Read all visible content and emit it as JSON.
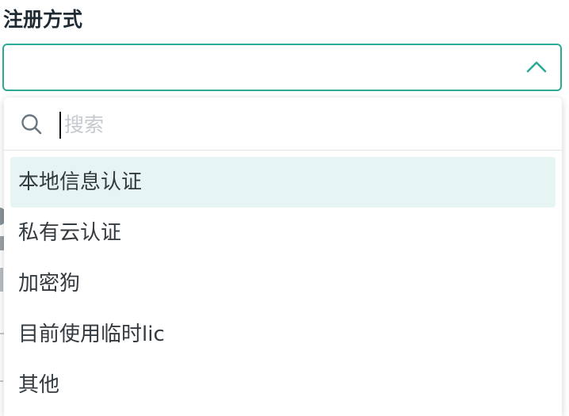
{
  "form": {
    "field_label": "注册方式",
    "selected_value": ""
  },
  "dropdown": {
    "search_placeholder": "搜索",
    "search_value": "",
    "options": [
      {
        "label": "本地信息认证",
        "highlighted": true
      },
      {
        "label": "私有云认证",
        "highlighted": false
      },
      {
        "label": "加密狗",
        "highlighted": false
      },
      {
        "label": "目前使用临时lic",
        "highlighted": false
      },
      {
        "label": "其他",
        "highlighted": false
      }
    ]
  },
  "colors": {
    "accent": "#2aaa97",
    "highlight_bg": "#e6f5f3",
    "placeholder": "#c4cad0"
  },
  "icons": {
    "expand_state": "chevron-up-icon",
    "search": "search-icon"
  }
}
